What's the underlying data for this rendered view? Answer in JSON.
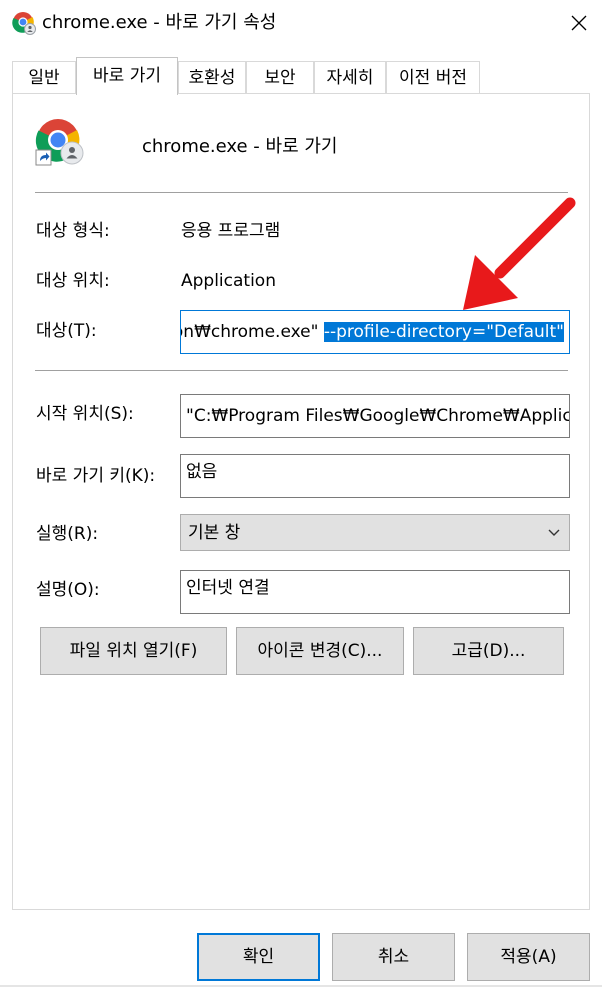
{
  "window": {
    "title": "chrome.exe - 바로 가기 속성",
    "icon": "chrome-shortcut-icon",
    "close_icon": "close-icon"
  },
  "tabs": [
    {
      "label": "일반",
      "active": false
    },
    {
      "label": "바로 가기",
      "active": true
    },
    {
      "label": "호환성",
      "active": false
    },
    {
      "label": "보안",
      "active": false
    },
    {
      "label": "자세히",
      "active": false
    },
    {
      "label": "이전 버전",
      "active": false
    }
  ],
  "shortcut": {
    "name": "chrome.exe - 바로 가기",
    "icon": "chrome-profile-icon"
  },
  "fields": {
    "target_type": {
      "label": "대상 형식:",
      "value": "응용 프로그램"
    },
    "target_location": {
      "label": "대상 위치:",
      "value": "Application"
    },
    "target": {
      "label": "대상(T):",
      "value_plain": "tion₩chrome.exe\" ",
      "value_selected": "--profile-directory=\"Default\""
    },
    "start_in": {
      "label": "시작 위치(S):",
      "value": "\"C:₩Program Files₩Google₩Chrome₩Applicati"
    },
    "shortcut_key": {
      "label": "바로 가기 키(K):",
      "value": "없음"
    },
    "run": {
      "label": "실행(R):",
      "value": "기본 창",
      "icon": "chevron-down-icon"
    },
    "comment": {
      "label": "설명(O):",
      "value": "인터넷 연결"
    }
  },
  "buttons": {
    "open_location": "파일 위치 열기(F)",
    "change_icon": "아이콘 변경(C)...",
    "advanced": "고급(D)...",
    "ok": "확인",
    "cancel": "취소",
    "apply": "적용(A)"
  },
  "annotation": {
    "arrow_color": "#e8191b",
    "icon": "red-arrow-annotation"
  },
  "colors": {
    "accent": "#0078d7",
    "button_bg": "#e1e1e1"
  }
}
